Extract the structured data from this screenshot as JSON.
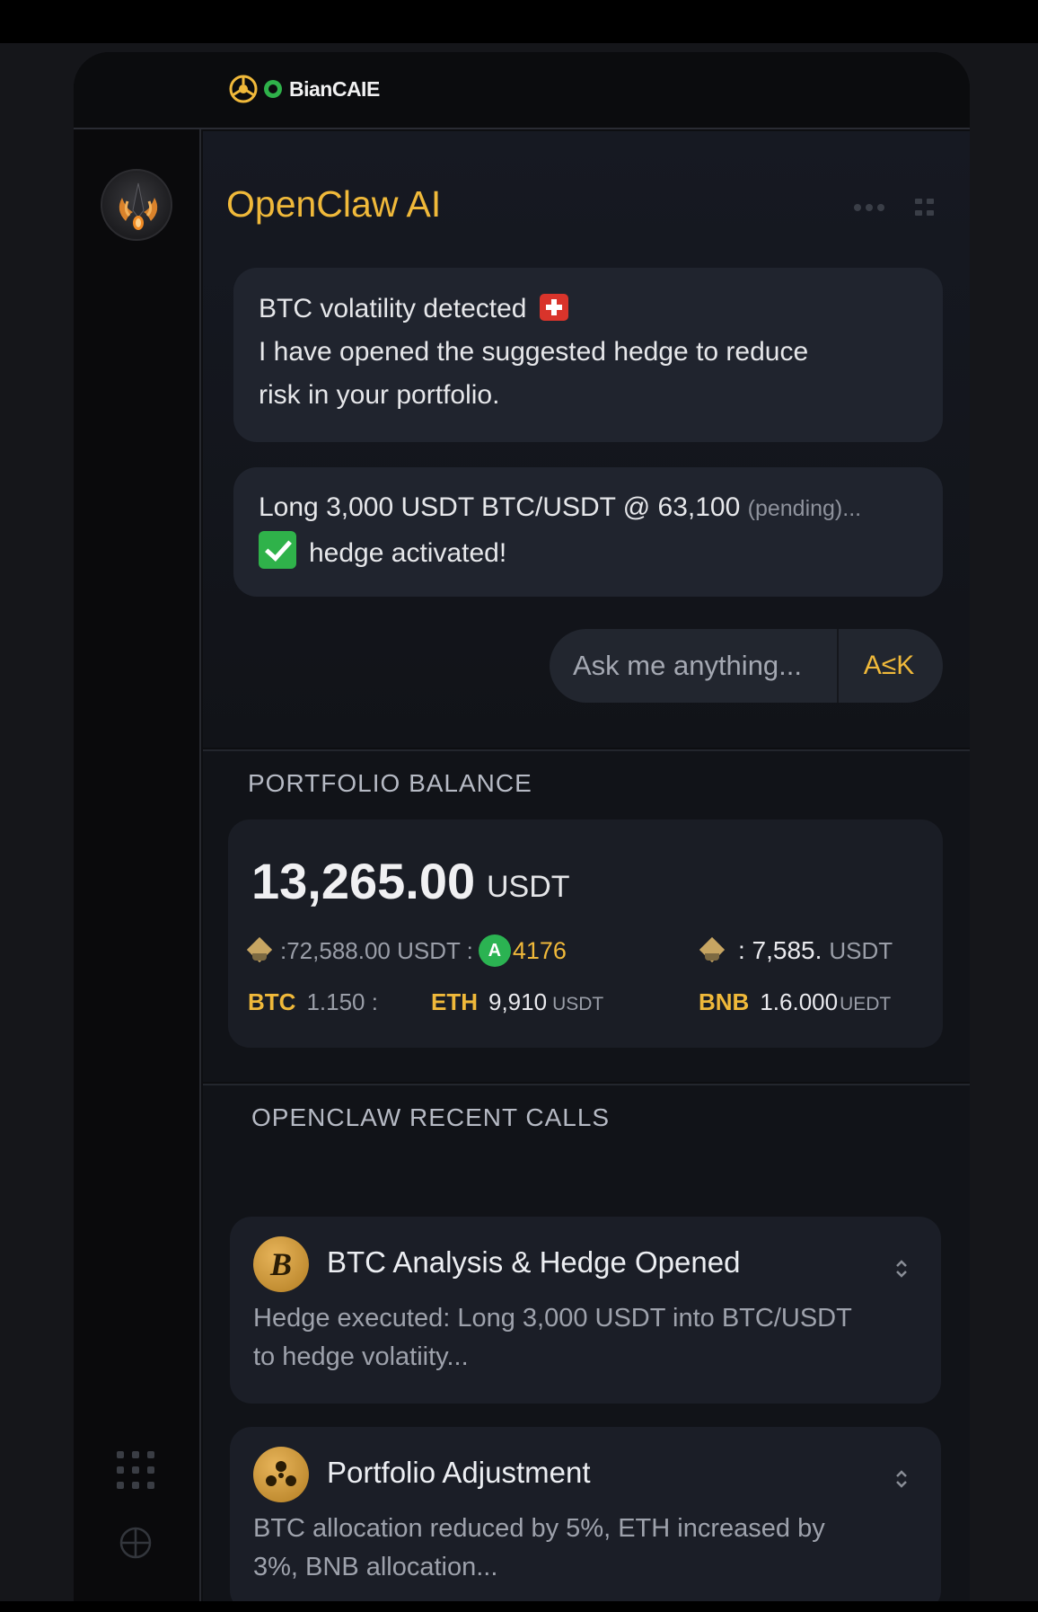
{
  "header": {
    "brand_name": "BianCAIE"
  },
  "chat": {
    "title": "OpenClaw AI",
    "message1": {
      "line1": "BTC volatility detected",
      "line2": "I have opened the suggested hedge to reduce",
      "line3": "risk in your portfolio."
    },
    "message2": {
      "order": "Long 3,000 USDT BTC/USDT @ 63,100",
      "status": "(pending)...",
      "confirmation": "hedge activated!"
    },
    "ask": {
      "placeholder": "Ask me anything...",
      "button_label": "A≤K"
    }
  },
  "portfolio": {
    "section_title": "PORTFOLIO BALANCE",
    "total_amount": "13,265.00",
    "total_unit": "USDT",
    "row1": {
      "left_value": ":72,588.00 USDT :",
      "badge_text": "Α",
      "mid_value": "4176",
      "right_value": ": 7,585.",
      "right_unit": "USDT"
    },
    "holdings": [
      {
        "symbol": "BTC",
        "amount": "1.150 :",
        "unit": ""
      },
      {
        "symbol": "ETH",
        "amount": "9,910",
        "unit": "USDT"
      },
      {
        "symbol": "BNB",
        "amount": "1.6.000",
        "unit": "UEDT"
      }
    ]
  },
  "calls": {
    "section_title": "OPENCLAW RECENT CALLS",
    "items": [
      {
        "icon_letter": "B",
        "title": "BTC Analysis & Hedge Opened",
        "body_line1": "Hedge executed: Long 3,000 USDT into  BTC/USDT",
        "body_line2": "to hedge volatiity..."
      },
      {
        "icon_letter": "",
        "title": "Portfolio Adjustment",
        "body_line1": "BTC allocation reduced by 5%, ETH increased by",
        "body_line2": "3%, BNB allocation..."
      }
    ]
  },
  "colors": {
    "accent_gold": "#f0b93a",
    "background": "#0d0e11",
    "bubble": "#20242e",
    "success_green": "#2fb24a",
    "alert_red": "#d9342b"
  },
  "icons": {
    "rail_logo": "binance-diamond-icon",
    "brand_mark": "brand-circle-icon",
    "avatar": "claw-avatar",
    "menu_more": "dots-icon",
    "layout": "grid-icon",
    "rail_apps": "apps-grid-icon",
    "rail_globe": "globe-icon"
  }
}
